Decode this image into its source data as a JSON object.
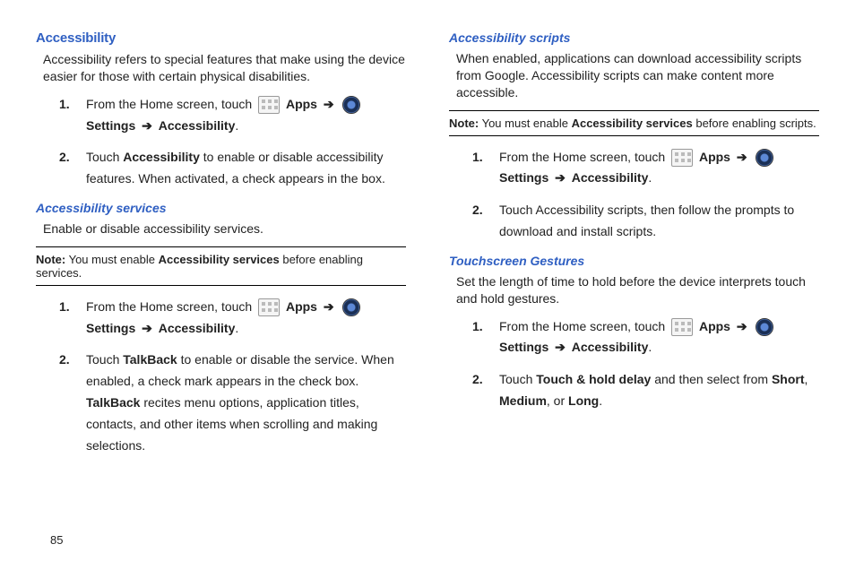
{
  "page_number": "85",
  "spacer": " ",
  "left": {
    "main_heading": "Accessibility",
    "intro": "Accessibility refers to special features that make using the device easier for those with certain physical disabilities.",
    "steps1": {
      "s1": {
        "prefix": "From the Home screen, touch ",
        "apps": "Apps",
        "settings": "Settings",
        "dest": "Accessibility"
      },
      "s2": {
        "t1": "Touch ",
        "b1": "Accessibility",
        "t2": " to enable or disable accessibility features. When activated, a check appears in the box."
      }
    },
    "sub2": "Accessibility services",
    "sub2_intro": "Enable or disable accessibility services.",
    "note1": {
      "label": "Note:",
      "t1": " You must enable ",
      "b": "Accessibility services",
      "t2": " before enabling services."
    },
    "steps2": {
      "s1": {
        "prefix": "From the Home screen, touch ",
        "apps": "Apps",
        "settings": "Settings",
        "dest": "Accessibility"
      },
      "s2": {
        "t1": "Touch ",
        "b1": "TalkBack",
        "t2": " to enable or disable the service. When enabled, a check mark appears in the check box. ",
        "b2": "TalkBack",
        "t3": " recites menu options, application titles, contacts, and other items when scrolling and making selections."
      }
    }
  },
  "right": {
    "sub1": "Accessibility scripts",
    "sub1_intro": "When enabled, applications can download accessibility scripts from Google. Accessibility scripts can make content more accessible.",
    "note1": {
      "label": "Note:",
      "t1": " You must enable ",
      "b": "Accessibility services",
      "t2": " before enabling scripts."
    },
    "steps1": {
      "s1": {
        "prefix": "From the Home screen, touch ",
        "apps": "Apps",
        "settings": "Settings",
        "dest": "Accessibility"
      },
      "s2": {
        "t1": "Touch Accessibility scripts, then follow the prompts to download and install scripts."
      }
    },
    "sub2": "Touchscreen Gestures",
    "sub2_intro": "Set the length of time to hold before the device interprets touch and hold gestures.",
    "steps2": {
      "s1": {
        "prefix": "From the Home screen, touch ",
        "apps": "Apps",
        "settings": "Settings",
        "dest": "Accessibility"
      },
      "s2": {
        "t1": "Touch ",
        "b1": "Touch & hold delay",
        "t2": " and then select from ",
        "b2": "Short",
        "comma": ", ",
        "b3": "Medium",
        "t3": ", or ",
        "b4": "Long",
        "period": "."
      }
    }
  }
}
